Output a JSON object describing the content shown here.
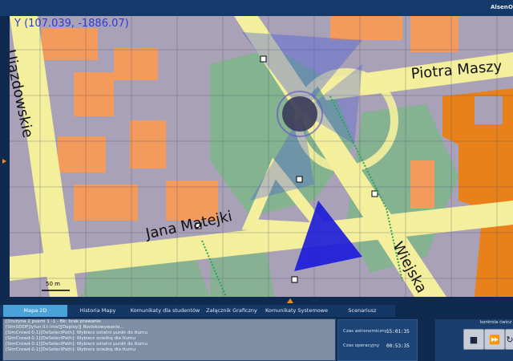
{
  "topbar": {
    "user_label": "Alsen",
    "extra_label": "O"
  },
  "map": {
    "coordinates": "(107.039, -1886.07)",
    "marker": "Y",
    "streets": {
      "ujazdowskie": "Ujazdowskie",
      "piotra": "Piotra Maszy",
      "jana": "Jana Matejki",
      "wiejska": "Wiejska"
    },
    "scale_label": "50 m"
  },
  "tabs": [
    {
      "label": "Mapa 2D"
    },
    {
      "label": "Historia Mapy"
    },
    {
      "label": "Komunikaty dla studentów"
    },
    {
      "label": "Załącznik Graficzny"
    },
    {
      "label": "Komunikaty Systemowe"
    },
    {
      "label": "Scenariusz"
    }
  ],
  "log": [
    "[Drużyna 2 psami 1 -1 - Bk: brak prawanie",
    "[SimSDDP]lyfun.ll.t.lmsl][Deploy][ Rozlokowywanie...",
    "[SimCrowd-0.1][DeSelectPath]: Wybierz ostatni punkt do tłumu",
    "[SimCrowd-0.1][DeSelectPath]: Wybierz ścieżkę dla tłumu",
    "[SimCrowd-0.1][DeSelectPath]: Wybierz ostatni punkt do tłumu",
    "[SimCrowd-0.1][DeSelectPath]: Wybierz ścieżkę dla tłumu"
  ],
  "times": {
    "astro_label": "Czas astronomiczny",
    "astro_value": "15:01:35",
    "oper_label": "Czas operacyjny",
    "oper_value": "00:53:35"
  },
  "controls": {
    "label": "kontrola ćwicz"
  },
  "colors": {
    "accent": "#4aa2d8",
    "panel": "#0f2a4e",
    "building": "#f39a5d",
    "road": "#f4ef9c",
    "park": "#7fb58b"
  }
}
